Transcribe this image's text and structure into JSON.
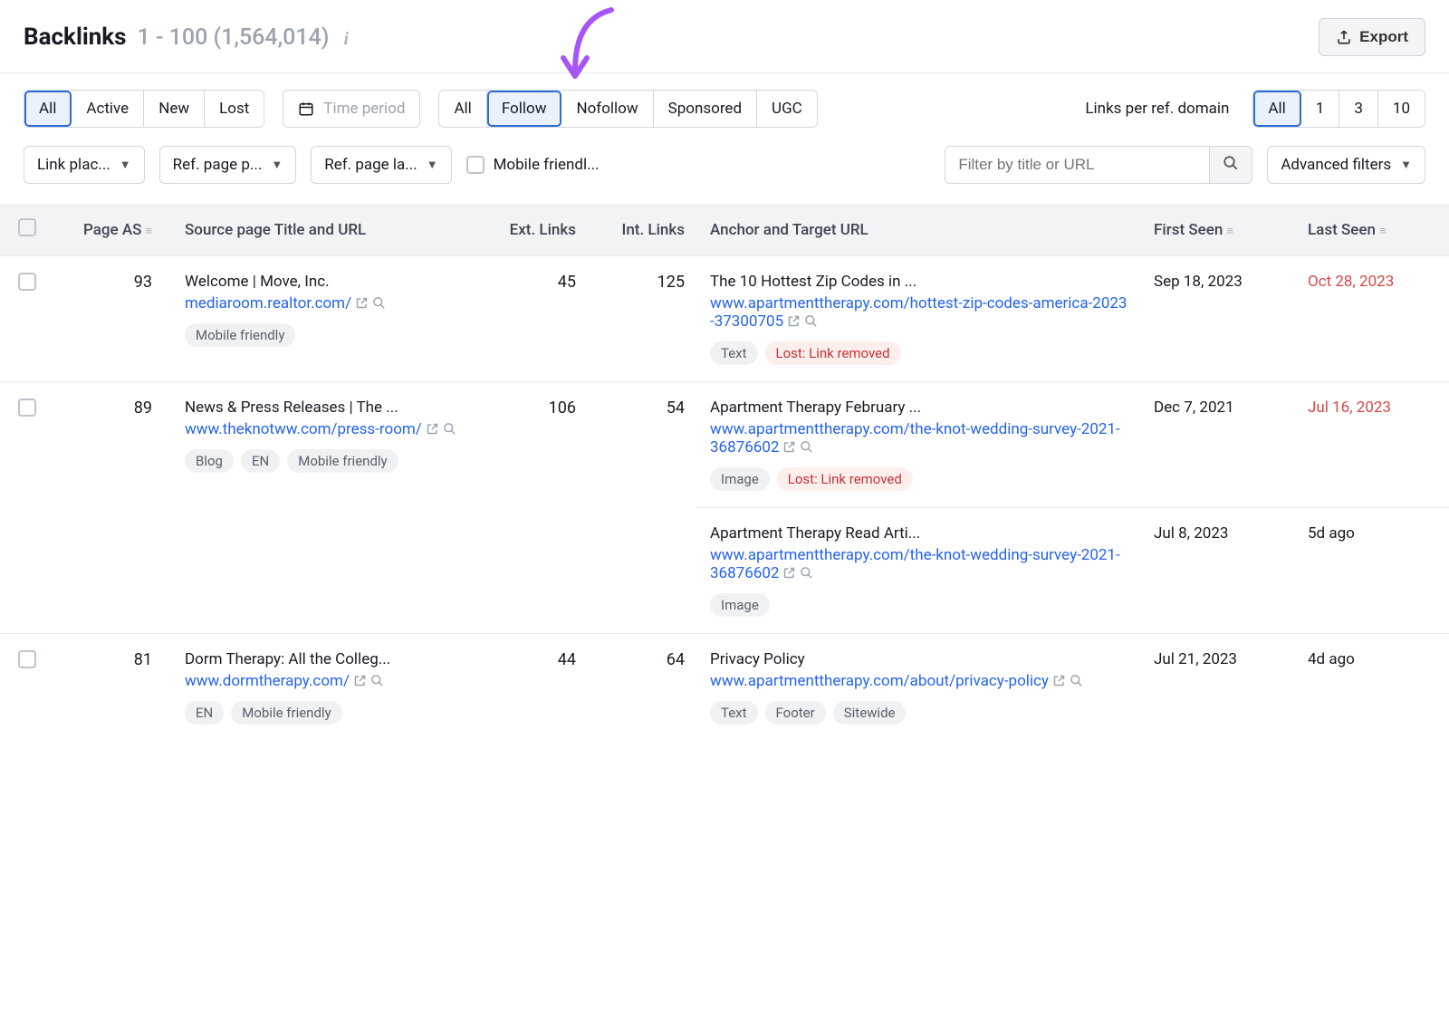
{
  "header": {
    "title": "Backlinks",
    "counts": "1 - 100 (1,564,014)",
    "export": "Export"
  },
  "filters": {
    "status": {
      "all": "All",
      "active": "Active",
      "new": "New",
      "lost": "Lost"
    },
    "time_period": "Time period",
    "rel": {
      "all": "All",
      "follow": "Follow",
      "nofollow": "Nofollow",
      "sponsored": "Sponsored",
      "ugc": "UGC"
    },
    "lpd_label": "Links per ref. domain",
    "lpd": {
      "all": "All",
      "one": "1",
      "three": "3",
      "ten": "10"
    },
    "link_placement": "Link plac...",
    "ref_page_p": "Ref. page p...",
    "ref_page_la": "Ref. page la...",
    "mobile_friendly": "Mobile friendl...",
    "search_placeholder": "Filter by title or URL",
    "advanced": "Advanced filters"
  },
  "columns": {
    "page_as": "Page AS",
    "source": "Source page Title and URL",
    "ext": "Ext. Links",
    "int": "Int. Links",
    "anchor": "Anchor and Target URL",
    "first_seen": "First Seen",
    "last_seen": "Last Seen"
  },
  "rows": [
    {
      "as": "93",
      "src_title": "Welcome | Move, Inc.",
      "src_url": "mediaroom.realtor.com/",
      "src_tags": [
        "Mobile friendly"
      ],
      "ext": "45",
      "int": "125",
      "anchors": [
        {
          "title": "The 10 Hottest Zip Codes in ...",
          "url": "www.apartmenttherapy.com/hottest-zip-codes-america-2023-37300705",
          "tags": [
            "Text"
          ],
          "lost": "Lost: Link removed",
          "first_seen": "Sep 18, 2023",
          "last_seen": "Oct 28, 2023",
          "last_red": true
        }
      ]
    },
    {
      "as": "89",
      "src_title": "News & Press Releases | The ...",
      "src_url": "www.theknotww.com/press-room/",
      "src_tags": [
        "Blog",
        "EN",
        "Mobile friendly"
      ],
      "ext": "106",
      "int": "54",
      "anchors": [
        {
          "title": "Apartment Therapy February ...",
          "url": "www.apartmenttherapy.com/the-knot-wedding-survey-2021-36876602",
          "tags": [
            "Image"
          ],
          "lost": "Lost: Link removed",
          "first_seen": "Dec 7, 2021",
          "last_seen": "Jul 16, 2023",
          "last_red": true
        },
        {
          "title": "Apartment Therapy Read Arti...",
          "url": "www.apartmenttherapy.com/the-knot-wedding-survey-2021-36876602",
          "tags": [
            "Image"
          ],
          "lost": null,
          "first_seen": "Jul 8, 2023",
          "last_seen": "5d ago",
          "last_red": false
        }
      ]
    },
    {
      "as": "81",
      "src_title": "Dorm Therapy: All the Colleg...",
      "src_url": "www.dormtherapy.com/",
      "src_tags": [
        "EN",
        "Mobile friendly"
      ],
      "ext": "44",
      "int": "64",
      "anchors": [
        {
          "title": "Privacy Policy",
          "url": "www.apartmenttherapy.com/about/privacy-policy",
          "tags": [
            "Text",
            "Footer",
            "Sitewide"
          ],
          "lost": null,
          "first_seen": "Jul 21, 2023",
          "last_seen": "4d ago",
          "last_red": false
        }
      ]
    }
  ]
}
